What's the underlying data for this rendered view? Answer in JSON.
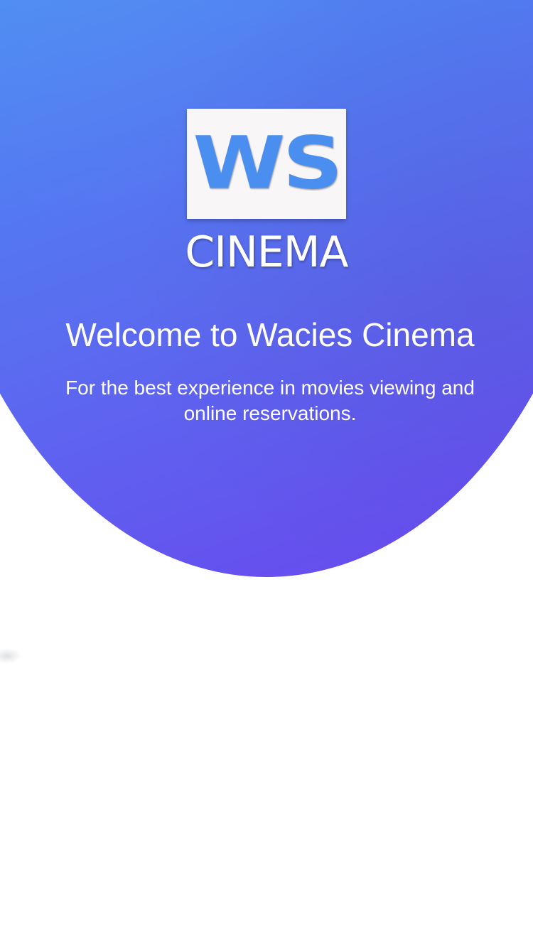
{
  "brand": {
    "logo_mark": "WS",
    "logo_word": "CINEMA",
    "accent_color": "#4a8ef0"
  },
  "welcome": {
    "title": "Welcome to Wacies Cinema",
    "subtitle": "For the best experience in movies viewing and online reservations."
  },
  "colors": {
    "gradient_start": "#35b6f6",
    "gradient_end": "#6a45ee",
    "background": "#ffffff"
  }
}
